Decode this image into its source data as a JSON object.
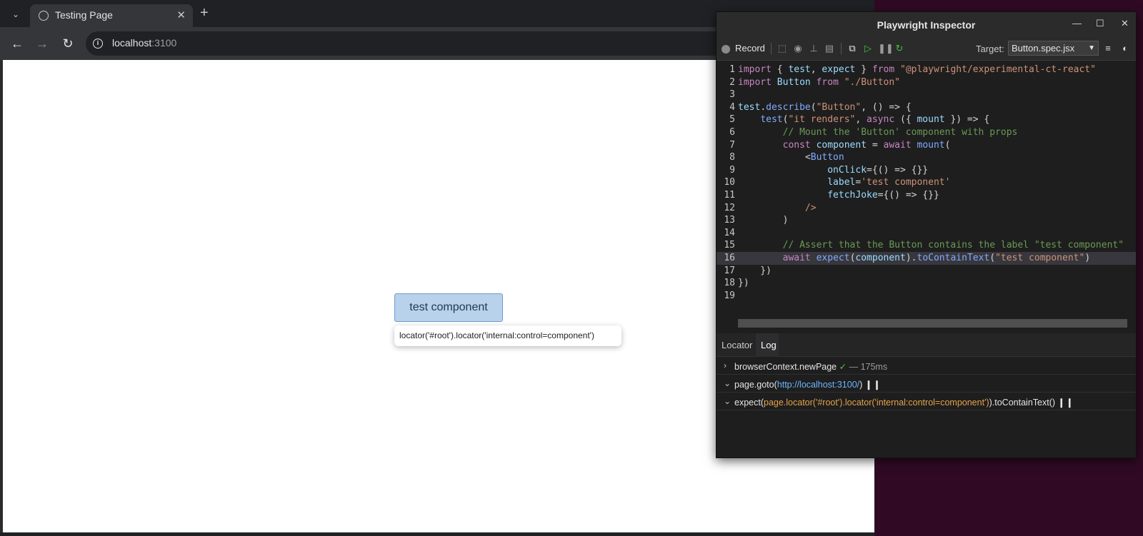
{
  "browser": {
    "tab_title": "Testing Page",
    "url_host": "localhost",
    "url_port": ":3100"
  },
  "page": {
    "button_label": "test component",
    "locator_tooltip": "locator('#root').locator('internal:control=component')"
  },
  "inspector": {
    "title": "Playwright Inspector",
    "record_label": "Record",
    "target_label": "Target:",
    "target_value": "Button.spec.jsx",
    "highlighted_line": 16,
    "tabs": [
      "Locator",
      "Log"
    ],
    "code_lines": [
      "import { test, expect } from \"@playwright/experimental-ct-react\"",
      "import Button from \"./Button\"",
      "",
      "test.describe(\"Button\", () => {",
      "    test(\"it renders\", async ({ mount }) => {",
      "        // Mount the 'Button' component with props",
      "        const component = await mount(",
      "            <Button",
      "                onClick={() => {}}",
      "                label='test component'",
      "                fetchJoke={() => {}}",
      "            />",
      "        )",
      "",
      "        // Assert that the Button contains the label \"test component\"",
      "        await expect(component).toContainText(\"test component\")",
      "    })",
      "})",
      ""
    ],
    "log": [
      {
        "text": "browserContext.newPage",
        "duration": "— 175ms"
      },
      {
        "prefix": "page.goto(",
        "link": "http://localhost:3100/",
        "suffix": ")"
      },
      {
        "prefix": "expect(",
        "locator": "page.locator('#root').locator('internal:control=component')",
        "suffix": ").toContainText()"
      }
    ]
  }
}
